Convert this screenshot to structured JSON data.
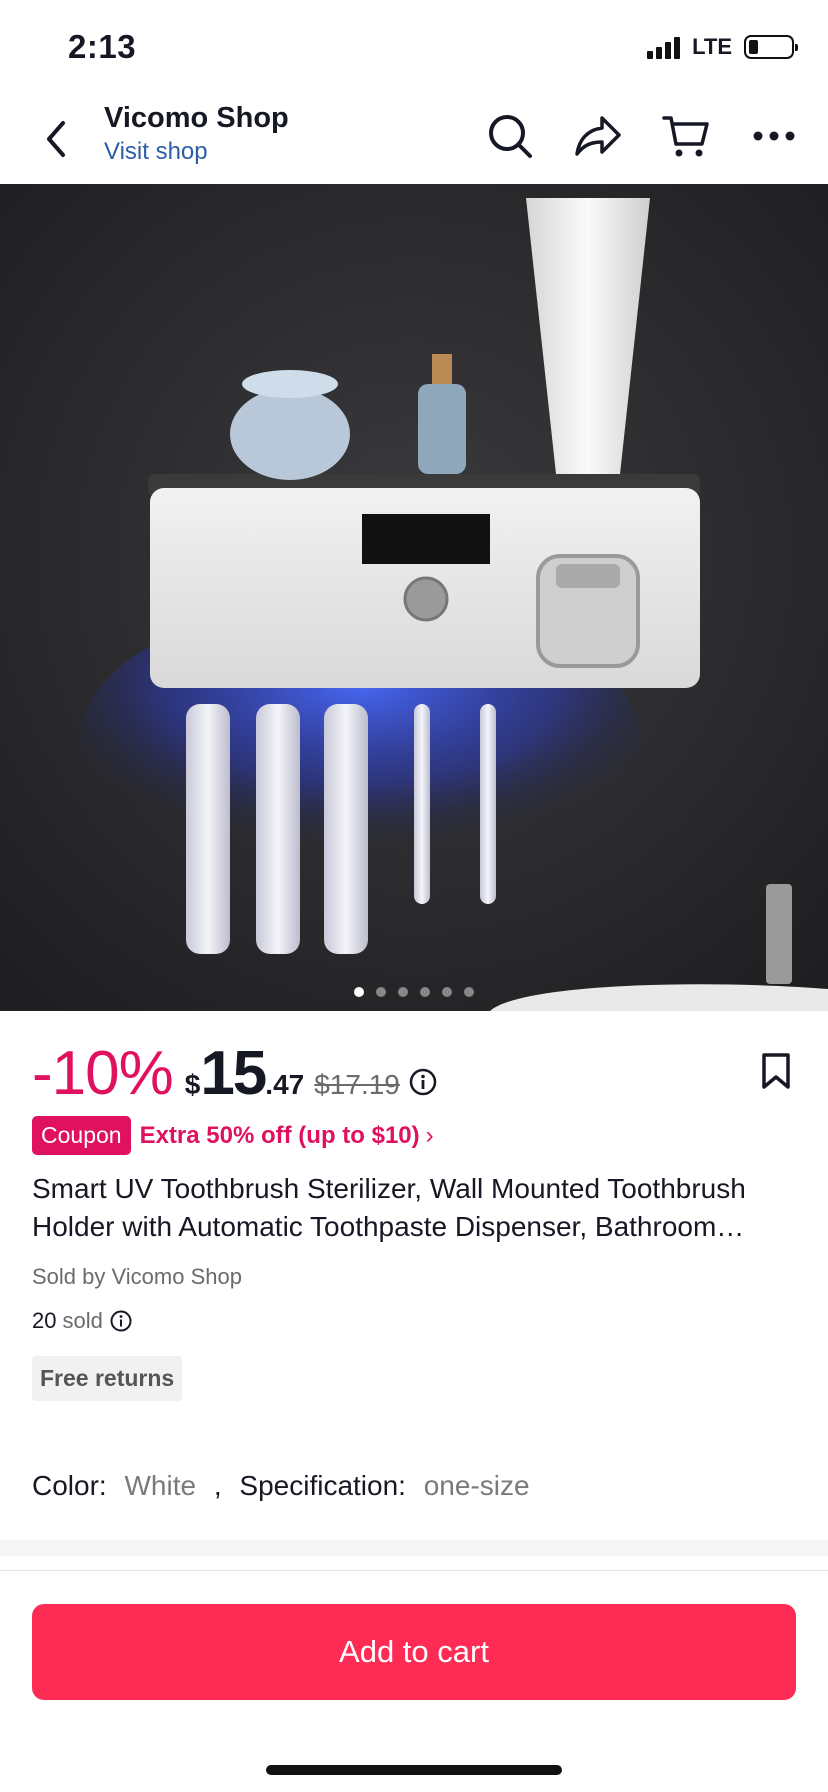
{
  "status": {
    "time": "2:13",
    "network": "LTE"
  },
  "nav": {
    "shop_name": "Vicomo Shop",
    "visit_shop": "Visit shop"
  },
  "gallery": {
    "image_count": 6,
    "active_index": 0
  },
  "price": {
    "discount": "-10%",
    "currency": "$",
    "integer": "15",
    "decimal": ".47",
    "original": "$17.19"
  },
  "coupon": {
    "badge": "Coupon",
    "text": "Extra 50% off (up to $10)",
    "chevron": "›"
  },
  "product": {
    "title": "Smart UV Toothbrush Sterilizer, Wall Mounted Toothbrush Holder with Automatic Toothpaste Dispenser, Bathroom Organizer",
    "sold_by": "Sold by Vicomo Shop",
    "sold_count": "20",
    "sold_label": "sold",
    "free_returns": "Free returns"
  },
  "spec": {
    "color_key": "Color:",
    "color_value": "White",
    "separator": ",",
    "spec_key": "Specification:",
    "spec_value": "one-size"
  },
  "cta": {
    "add_to_cart": "Add to cart"
  },
  "colors": {
    "accent": "#fe2c55",
    "discount": "#e0115f",
    "link": "#2b5ea7"
  }
}
